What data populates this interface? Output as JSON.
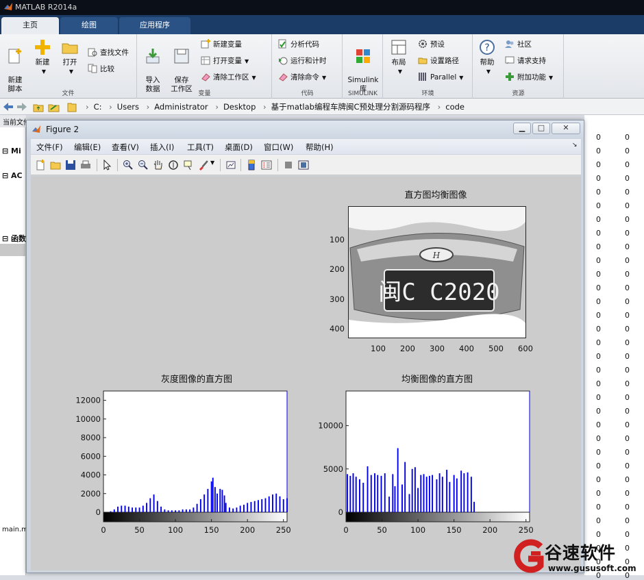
{
  "app": {
    "title": "MATLAB R2014a"
  },
  "ribbon_tabs": [
    {
      "label": "主页",
      "active": true
    },
    {
      "label": "绘图",
      "active": false
    },
    {
      "label": "应用程序",
      "active": false
    }
  ],
  "ribbon": {
    "file": {
      "label": "文件",
      "new_script": "新建\n脚本",
      "new": "新建",
      "open": "打开",
      "find_files": "查找文件",
      "compare": "比较"
    },
    "variable": {
      "label": "变量",
      "import": "导入\n数据",
      "save_ws": "保存\n工作区",
      "new_var": "新建变量",
      "open_var": "打开变量",
      "clear_ws": "清除工作区"
    },
    "code": {
      "label": "代码",
      "analyze": "分析代码",
      "run_time": "运行和计时",
      "clear_cmds": "清除命令"
    },
    "simulink": {
      "label": "SIMULINK",
      "lib": "Simulink\n库"
    },
    "env": {
      "label": "环境",
      "layout": "布局",
      "prefs": "预设",
      "set_path": "设置路径",
      "parallel": "Parallel"
    },
    "resources": {
      "label": "资源",
      "help": "帮助",
      "community": "社区",
      "support": "请求支持",
      "addons": "附加功能"
    }
  },
  "address": {
    "crumbs": [
      "C:",
      "Users",
      "Administrator",
      "Desktop",
      "基于matlab编程车牌闽C预处理分割源码程序",
      "code"
    ]
  },
  "left_pane": {
    "header": "当前文件夹",
    "row1": "Mi",
    "row2": "AC",
    "row3": "函数",
    "bottom": "main.m"
  },
  "right_pane": {
    "value": "0"
  },
  "figure": {
    "title": "Figure 2",
    "menu": [
      "文件(F)",
      "编辑(E)",
      "查看(V)",
      "插入(I)",
      "工具(T)",
      "桌面(D)",
      "窗口(W)",
      "帮助(H)"
    ],
    "plots": {
      "eq_image": {
        "title": "直方图均衡图像",
        "plate_text": "闽C C2020",
        "yticks": [
          "100",
          "200",
          "300",
          "400"
        ],
        "xticks": [
          "100",
          "200",
          "300",
          "400",
          "500",
          "600"
        ]
      },
      "gray_hist": {
        "title": "灰度图像的直方图"
      },
      "eq_hist": {
        "title": "均衡图像的直方图"
      }
    }
  },
  "colors": {
    "bar": "#0000ee",
    "canvas": "#cccccc",
    "title_dark": "#0b1018",
    "tab_bar": "#1b3c66"
  },
  "chart_data": [
    {
      "type": "bar",
      "title": "灰度图像的直方图",
      "xlim": [
        0,
        255
      ],
      "ylim": [
        0,
        13000
      ],
      "xticks": [
        0,
        50,
        100,
        150,
        200,
        250
      ],
      "yticks": [
        0,
        2000,
        4000,
        6000,
        8000,
        10000,
        12000
      ],
      "x": [
        0,
        5,
        10,
        15,
        20,
        25,
        30,
        35,
        40,
        45,
        50,
        55,
        60,
        65,
        70,
        75,
        80,
        85,
        90,
        95,
        100,
        105,
        110,
        115,
        120,
        125,
        130,
        135,
        140,
        145,
        150,
        152,
        155,
        158,
        162,
        165,
        168,
        170,
        175,
        180,
        185,
        190,
        195,
        200,
        205,
        210,
        215,
        220,
        225,
        230,
        235,
        240,
        245,
        250,
        255
      ],
      "values": [
        0,
        0,
        100,
        300,
        600,
        700,
        700,
        600,
        500,
        500,
        500,
        700,
        1000,
        1500,
        1900,
        1200,
        600,
        300,
        200,
        200,
        200,
        200,
        300,
        300,
        300,
        500,
        900,
        1400,
        1900,
        2500,
        3300,
        3700,
        2700,
        2000,
        2500,
        2400,
        1800,
        1000,
        500,
        400,
        500,
        700,
        800,
        1000,
        1100,
        1200,
        1300,
        1400,
        1500,
        1700,
        1900,
        2000,
        1700,
        1400,
        1500
      ]
    },
    {
      "type": "bar",
      "title": "均衡图像的直方图",
      "xlim": [
        0,
        255
      ],
      "ylim": [
        0,
        14000
      ],
      "xticks": [
        0,
        50,
        100,
        150,
        200,
        250
      ],
      "yticks": [
        0,
        5000,
        10000
      ],
      "x": [
        2,
        6,
        10,
        14,
        19,
        24,
        30,
        35,
        40,
        44,
        49,
        54,
        60,
        65,
        68,
        72,
        78,
        82,
        88,
        92,
        96,
        100,
        104,
        108,
        112,
        116,
        120,
        126,
        130,
        134,
        140,
        144,
        150,
        154,
        160,
        164,
        169,
        174,
        178
      ],
      "values": [
        4400,
        4200,
        4500,
        4100,
        3800,
        3400,
        5300,
        4300,
        4500,
        4300,
        4200,
        4500,
        1800,
        4400,
        3000,
        7400,
        3200,
        5800,
        2100,
        5000,
        5200,
        2800,
        4300,
        4400,
        4100,
        4200,
        4300,
        3800,
        4500,
        4100,
        4900,
        3500,
        4300,
        3900,
        4800,
        4500,
        4600,
        4100,
        1200
      ]
    }
  ]
}
